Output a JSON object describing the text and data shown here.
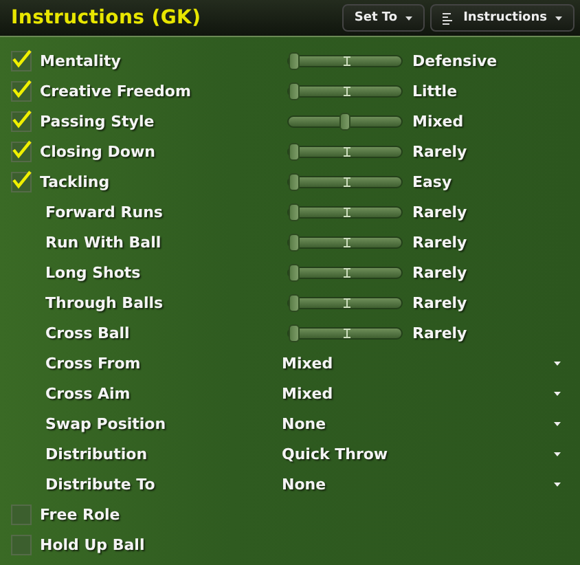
{
  "header": {
    "title": "Instructions (GK)",
    "buttons": [
      {
        "label": "Set To",
        "icon": false
      },
      {
        "label": "Instructions",
        "icon": true
      }
    ]
  },
  "rows": [
    {
      "kind": "slider",
      "label": "Mentality",
      "checked": true,
      "level": 0,
      "value": "Defensive"
    },
    {
      "kind": "slider",
      "label": "Creative Freedom",
      "checked": true,
      "level": 0,
      "value": "Little"
    },
    {
      "kind": "slider",
      "label": "Passing Style",
      "checked": true,
      "level": 0.5,
      "value": "Mixed"
    },
    {
      "kind": "slider",
      "label": "Closing Down",
      "checked": true,
      "level": 0,
      "value": "Rarely"
    },
    {
      "kind": "slider",
      "label": "Tackling",
      "checked": true,
      "level": 0,
      "value": "Easy"
    },
    {
      "kind": "slider",
      "label": "Forward Runs",
      "level": 0,
      "value": "Rarely"
    },
    {
      "kind": "slider",
      "label": "Run With Ball",
      "level": 0,
      "value": "Rarely"
    },
    {
      "kind": "slider",
      "label": "Long Shots",
      "level": 0,
      "value": "Rarely"
    },
    {
      "kind": "slider",
      "label": "Through Balls",
      "level": 0,
      "value": "Rarely"
    },
    {
      "kind": "slider",
      "label": "Cross Ball",
      "level": 0,
      "value": "Rarely"
    },
    {
      "kind": "dropdown",
      "label": "Cross From",
      "value": "Mixed"
    },
    {
      "kind": "dropdown",
      "label": "Cross Aim",
      "value": "Mixed"
    },
    {
      "kind": "dropdown",
      "label": "Swap Position",
      "value": "None"
    },
    {
      "kind": "dropdown",
      "label": "Distribution",
      "value": "Quick Throw"
    },
    {
      "kind": "dropdown",
      "label": "Distribute To",
      "value": "None"
    },
    {
      "kind": "checkbox",
      "label": "Free Role",
      "checked": false
    },
    {
      "kind": "checkbox",
      "label": "Hold Up Ball",
      "checked": false
    }
  ]
}
